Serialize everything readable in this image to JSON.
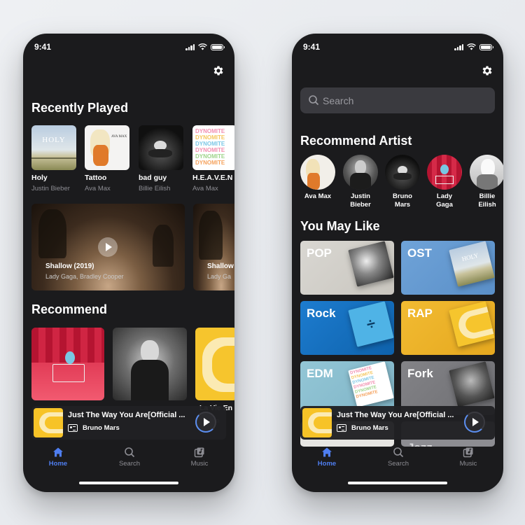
{
  "status": {
    "time": "9:41"
  },
  "left": {
    "recent_title": "Recently Played",
    "recent": [
      {
        "title": "Holy",
        "artist": "Justin Bieber",
        "cover": "holy"
      },
      {
        "title": "Tattoo",
        "artist": "Ava Max",
        "cover": "tattoo"
      },
      {
        "title": "bad guy",
        "artist": "Billie Eilish",
        "cover": "badguy"
      },
      {
        "title": "H.E.A.V.E.N",
        "artist": "Ava Max",
        "cover": "dynamite"
      }
    ],
    "videos": [
      {
        "title": "Shallow (2019)",
        "subtitle": "Lady Gaga, Bradley Cooper"
      },
      {
        "title": "Shallow",
        "subtitle": "Lady Ga"
      }
    ],
    "recommend_title": "Recommend",
    "recommend_peek": [
      "La Vie En",
      "ga"
    ]
  },
  "right": {
    "search_placeholder": "Search",
    "artist_title": "Recommend Artist",
    "artists": [
      {
        "name": "Ava Max"
      },
      {
        "name": "Justin\nBieber"
      },
      {
        "name": "Bruno\nMars"
      },
      {
        "name": "Lady\nGaga"
      },
      {
        "name": "Billie\nEilish"
      }
    ],
    "like_title": "You May Like",
    "genres": [
      {
        "label": "POP",
        "color": "#d7d5d0"
      },
      {
        "label": "OST",
        "color": "#6ea0d6"
      },
      {
        "label": "Rock",
        "color": "#1b76c7"
      },
      {
        "label": "RAP",
        "color": "#f0b62b"
      },
      {
        "label": "EDM",
        "color": "#8ec3d4"
      },
      {
        "label": "Fork",
        "color": "#7c7c80"
      }
    ],
    "peek": "Jazz"
  },
  "mini_player": {
    "title": "Just The Way You Are[Official ...",
    "artist": "Bruno Mars"
  },
  "tabs": [
    {
      "label": "Home",
      "icon": "home-icon"
    },
    {
      "label": "Search",
      "icon": "search-icon"
    },
    {
      "label": "Music",
      "icon": "music-library-icon"
    }
  ],
  "colors": {
    "accent": "#4f7ef0",
    "background": "#1b1b1d",
    "muted": "#8d8d93"
  }
}
